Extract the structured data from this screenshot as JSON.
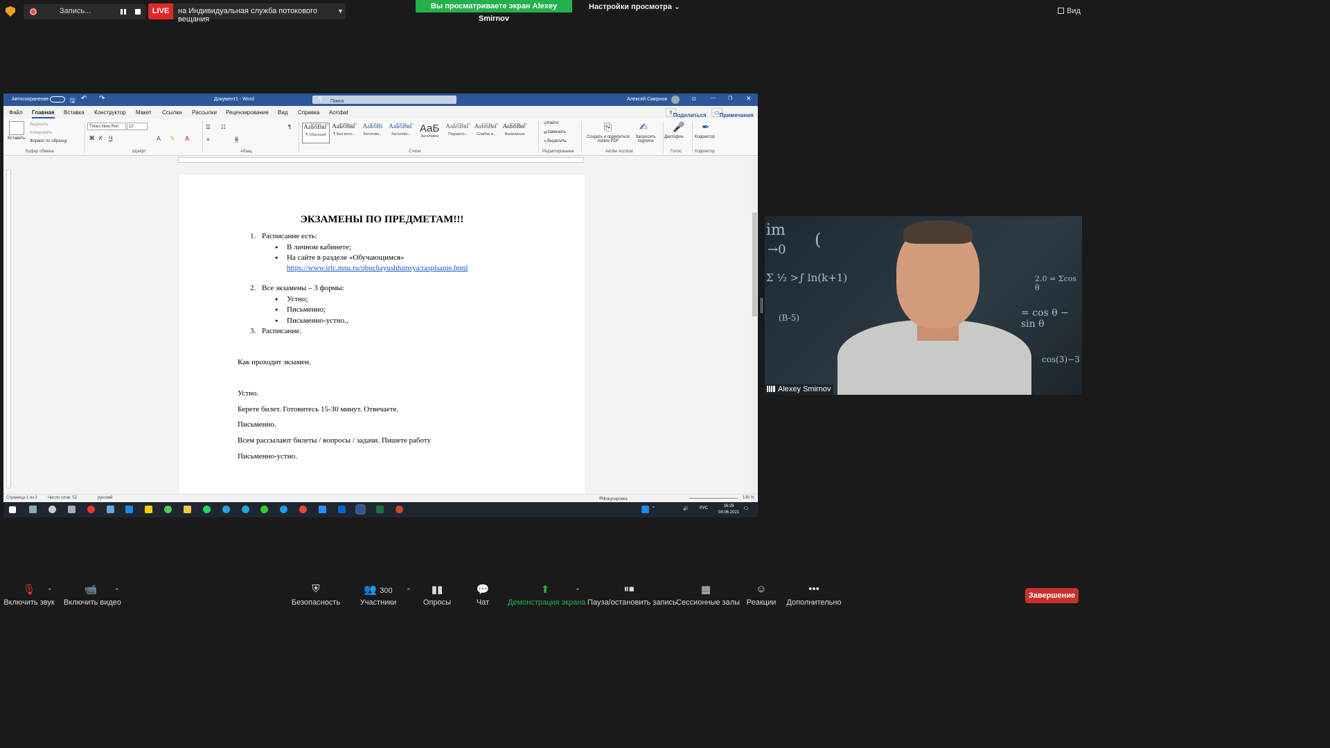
{
  "top": {
    "recording_label": "Запись...",
    "live_badge": "LIVE",
    "live_target": "на Индивидуальная служба потокового вещания",
    "viewing_banner": "Вы просматриваете экран Alexey Smirnov",
    "view_settings": "Настройки просмотра ⌄",
    "view_button": "Вид"
  },
  "word": {
    "autosave": "Автосохранение",
    "doc_title": "Документ1 - Word",
    "search_placeholder": "Поиск",
    "user_name": "Алексей Смирнов",
    "tabs": [
      "Файл",
      "Главная",
      "Вставка",
      "Конструктор",
      "Макет",
      "Ссылки",
      "Рассылки",
      "Рецензирование",
      "Вид",
      "Справка",
      "Acrobat"
    ],
    "share": "Поделиться",
    "comments": "Примечания",
    "ribbon": {
      "paste": "Вставить",
      "cut": "Вырезать",
      "copy": "Копировать",
      "format_painter": "Формат по образцу",
      "font_name": "Times New Ron",
      "font_size": "12",
      "find": "Найти",
      "replace": "Заменить",
      "select": "Выделить",
      "adobe_create": "Создать и поделиться Adobe PDF",
      "request_sign": "Запросить подписи",
      "dictate": "Диктофон",
      "editor": "Корректор",
      "groups": [
        "Буфер обмена",
        "Шрифт",
        "Абзац",
        "Стили",
        "Редактирование",
        "Adobe Acrobat",
        "Голос",
        "Корректор"
      ],
      "styles": [
        {
          "sample": "АаБбВвГ",
          "name": "¶ Обычный"
        },
        {
          "sample": "АаБбВвГ",
          "name": "¶ Без инте..."
        },
        {
          "sample": "АаБбВі",
          "name": "Заголово..."
        },
        {
          "sample": "АаБбВвГ",
          "name": "Заголово..."
        },
        {
          "sample": "АаБ",
          "name": "Заголовок"
        },
        {
          "sample": "АаБбВвГ",
          "name": "Подзагол..."
        },
        {
          "sample": "АаБбВвГ",
          "name": "Слабое в..."
        },
        {
          "sample": "АаБбВвГ",
          "name": "Выделение"
        }
      ]
    },
    "doc": {
      "heading": "ЭКЗАМЕНЫ ПО ПРЕДМЕТАМ!!!",
      "item1_num": "1.",
      "item1": "Расписание есть:",
      "b1": "В личном кабинете;",
      "b2": "На сайте в разделе «Обучающимся»",
      "link": "https://www.irlc.msu.ru/obuchayushhimsya/raspisanie.html",
      "item2_num": "2.",
      "item2": "Все экзамены – 3 формы:",
      "b3": "Устно;",
      "b4": "Письменно;",
      "b5": "Письменно-устно.,",
      "item3_num": "3.",
      "item3": "Расписание.",
      "p1": "Как проходит экзамен.",
      "p2": "Устно.",
      "p3": "Берете билет. Готовитесь 15-30 минут. Отвечаете.",
      "p4": "Письменно.",
      "p5": "Всем рассылают билеты / вопросы / задачи. Пишете работу",
      "p6": "Письменно-устно."
    },
    "status": {
      "page": "Страница 1 из 2",
      "words": "Число слов: 52",
      "lang": "русский",
      "focus": "Фокусировка",
      "zoom": "130 %"
    },
    "taskbar": {
      "lang": "РУС",
      "time": "16:29",
      "date": "04.06.2021"
    }
  },
  "camera": {
    "name": "Alexey Smirnov"
  },
  "toolbar": {
    "mute": "Включить звук",
    "video": "Включить видео",
    "security": "Безопасность",
    "participants": "Участники",
    "participants_count": "300",
    "polls": "Опросы",
    "chat": "Чат",
    "share": "Демонстрация экрана",
    "pause_record": "Пауза/остановить запись",
    "breakout": "Сессионные залы",
    "reactions": "Реакции",
    "more": "Дополнительно",
    "end": "Завершение"
  },
  "colors": {
    "word_blue": "#2b579a",
    "live_red": "#e02828",
    "banner_green": "#22b14c",
    "share_green": "#22b14c",
    "end_red": "#c9302c"
  }
}
